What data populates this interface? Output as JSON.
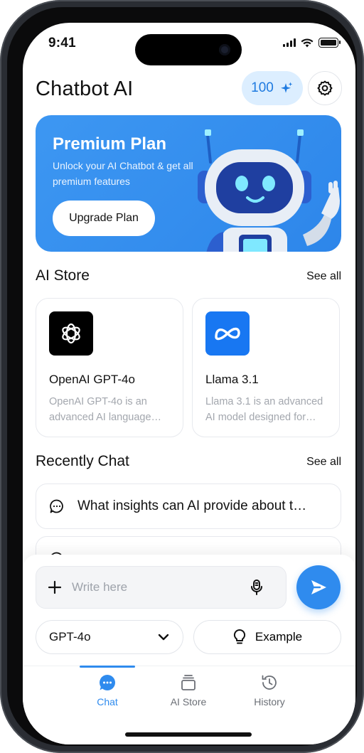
{
  "status_bar": {
    "time": "9:41"
  },
  "header": {
    "title": "Chatbot AI",
    "credits": "100"
  },
  "banner": {
    "title": "Premium Plan",
    "subtitle": "Unlock your AI Chatbot & get all premium features",
    "button_label": "Upgrade Plan"
  },
  "ai_store": {
    "title": "AI Store",
    "see_all": "See all",
    "cards": [
      {
        "name": "OpenAI GPT-4o",
        "description": "OpenAI GPT-4o is an advanced AI language…",
        "icon": "openai-logo-icon"
      },
      {
        "name": "Llama 3.1",
        "description": "Llama 3.1 is an advanced AI model designed for…",
        "icon": "meta-logo-icon"
      }
    ]
  },
  "recent_chat": {
    "title": "Recently Chat",
    "see_all": "See all",
    "items": [
      {
        "text": "What insights can AI provide about t…",
        "icon": "chat-bubble-icon"
      },
      {
        "text": "",
        "icon": "chat-bubble-icon"
      }
    ]
  },
  "composer": {
    "placeholder": "Write here",
    "model": "GPT-4o",
    "example_label": "Example"
  },
  "tabs": [
    {
      "label": "Chat",
      "icon": "chat-icon",
      "active": true
    },
    {
      "label": "AI Store",
      "icon": "stack-icon",
      "active": false
    },
    {
      "label": "History",
      "icon": "history-icon",
      "active": false
    }
  ],
  "colors": {
    "accent": "#2f8bee",
    "banner": "#3d97f2",
    "credits_bg": "#dceeff"
  }
}
